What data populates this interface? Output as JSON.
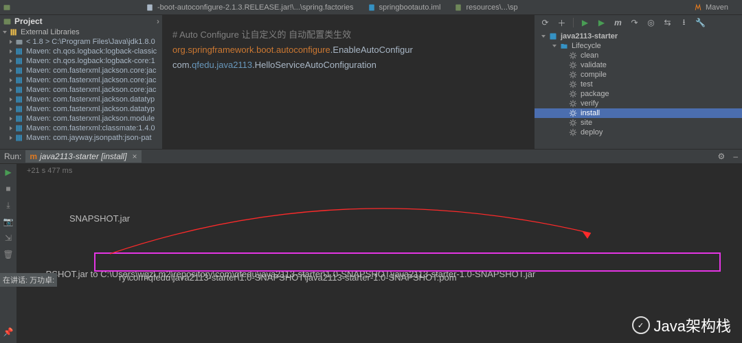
{
  "tabs": [
    {
      "label": "-boot-autoconfigure-2.1.3.RELEASE.jar!\\...\\spring.factories"
    },
    {
      "label": "springbootauto.iml"
    },
    {
      "label": "resources\\...\\sp"
    }
  ],
  "project": {
    "title": "Project",
    "section": "External Libraries",
    "jdk": "< 1.8 > C:\\Program Files\\Java\\jdk1.8.0",
    "items": [
      "Maven: ch.qos.logback:logback-classic",
      "Maven: ch.qos.logback:logback-core:1",
      "Maven: com.fasterxml.jackson.core:jac",
      "Maven: com.fasterxml.jackson.core:jac",
      "Maven: com.fasterxml.jackson.core:jac",
      "Maven: com.fasterxml.jackson.datatyp",
      "Maven: com.fasterxml.jackson.datatyp",
      "Maven: com.fasterxml.jackson.module",
      "Maven: com.fasterxml:classmate:1.4.0",
      "Maven: com.jayway.jsonpath:json-pat"
    ]
  },
  "editor": {
    "line1_comment": "# Auto Configure",
    "line1_cjk": "   让自定义的 自动配置类生效",
    "line2_pkg": "org.springframework.boot.autoconfigure",
    "line2_cls": ".EnableAutoConfigur",
    "line3_p1": "com.",
    "line3_p2": "qfedu",
    "line3_p3": ".",
    "line3_p4": "java2113",
    "line3_p5": ".HelloServiceAutoConfiguration"
  },
  "maven": {
    "title": "Maven",
    "module": "java2113-starter",
    "lifecycle": "Lifecycle",
    "goals": [
      "clean",
      "validate",
      "compile",
      "test",
      "package",
      "verify",
      "install",
      "site",
      "deploy"
    ],
    "selected": "install"
  },
  "run": {
    "label": "Run:",
    "tab": "java2113-starter [install]",
    "timing": "+21 s 477 ms",
    "l_snapshot": "SNAPSHOT.jar",
    "l_pshot": "PSHOT.jar to ",
    "l_jarpath": "C:\\Users\\wgz\\.m2\\repository\\com\\qfedu\\java2113-starter\\1.0-SNAPSHOT\\java2113-starter-1.0-SNAPSHOT.jar",
    "l_pom": "ry\\com\\qfedu\\java2113-starter\\1.0-SNAPSHOT\\java2113-starter-1.0-SNAPSHOT.pom"
  },
  "overlay": {
    "presenter": "在讲话: 万功卓:",
    "watermark": "Java架构栈"
  }
}
